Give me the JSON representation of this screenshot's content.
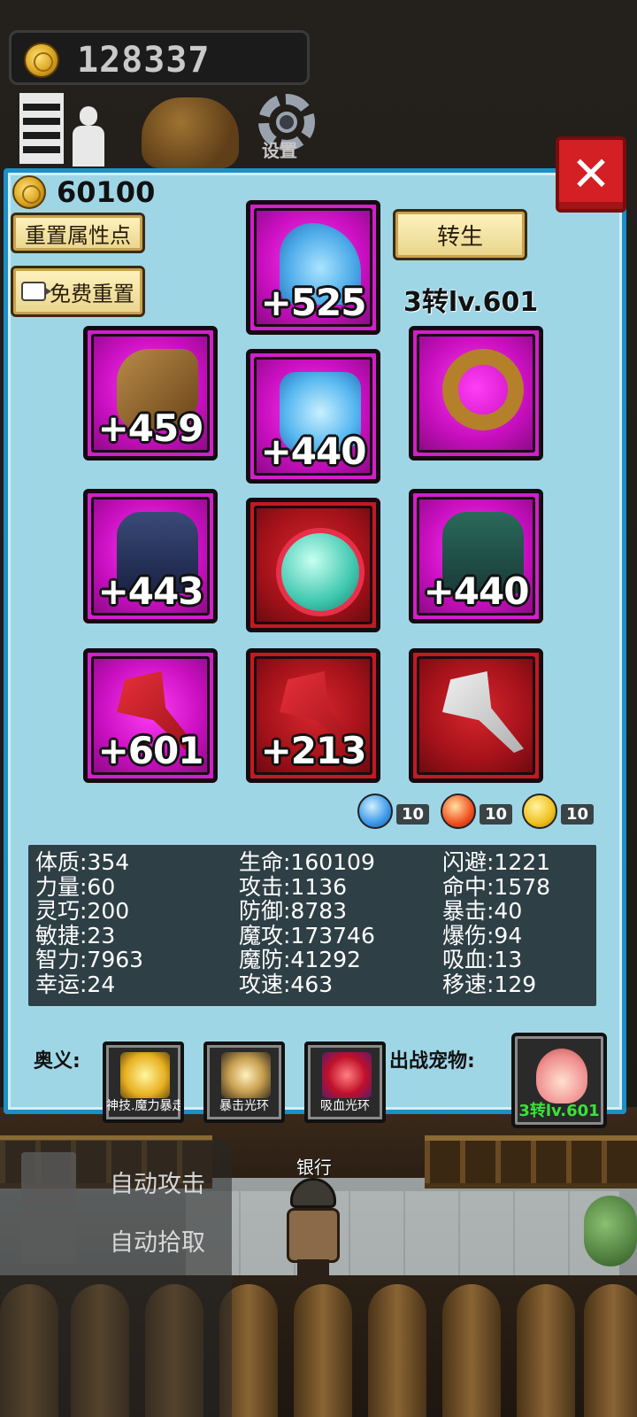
{
  "hud": {
    "gold": "128337",
    "settings_label": "设置"
  },
  "panel": {
    "gold": "60100",
    "reset_points_label": "重置属性点",
    "free_reset_label": "免费重置",
    "rebirth_label": "转生",
    "rebirth_level": "3转lv.601"
  },
  "equipment": [
    {
      "slot": "hat",
      "bonus": "+525",
      "rarity": "purple"
    },
    {
      "slot": "glove",
      "bonus": "+459",
      "rarity": "purple"
    },
    {
      "slot": "armor",
      "bonus": "+440",
      "rarity": "purple"
    },
    {
      "slot": "ring",
      "bonus": "",
      "rarity": "purple"
    },
    {
      "slot": "boots",
      "bonus": "+443",
      "rarity": "purple"
    },
    {
      "slot": "amulet",
      "bonus": "",
      "rarity": "red"
    },
    {
      "slot": "legs",
      "bonus": "+440",
      "rarity": "purple"
    },
    {
      "slot": "weapon",
      "bonus": "+601",
      "rarity": "purple"
    },
    {
      "slot": "offhand",
      "bonus": "+213",
      "rarity": "red"
    },
    {
      "slot": "axe",
      "bonus": "",
      "rarity": "red"
    }
  ],
  "gems": {
    "water": "10",
    "fire": "10",
    "thunder": "10"
  },
  "stats": {
    "col1": [
      "体质:354",
      "力量:60",
      "灵巧:200",
      "敏捷:23",
      "智力:7963",
      "幸运:24"
    ],
    "col2": [
      "生命:160109",
      "攻击:1136",
      "防御:8783",
      "魔攻:173746",
      "魔防:41292",
      "攻速:463"
    ],
    "col3": [
      "闪避:1221",
      "命中:1578",
      "暴击:40",
      "爆伤:94",
      "吸血:13",
      "移速:129"
    ]
  },
  "skills": {
    "label": "奥义:",
    "items": [
      "神技.魔力暴走",
      "暴击光环",
      "吸血光环"
    ]
  },
  "pet": {
    "label": "出战宠物:",
    "level": "3转lv.601"
  },
  "scene": {
    "npc_label": "银行",
    "auto_attack": "自动攻击",
    "auto_pickup": "自动拾取"
  },
  "close_label": "✕"
}
